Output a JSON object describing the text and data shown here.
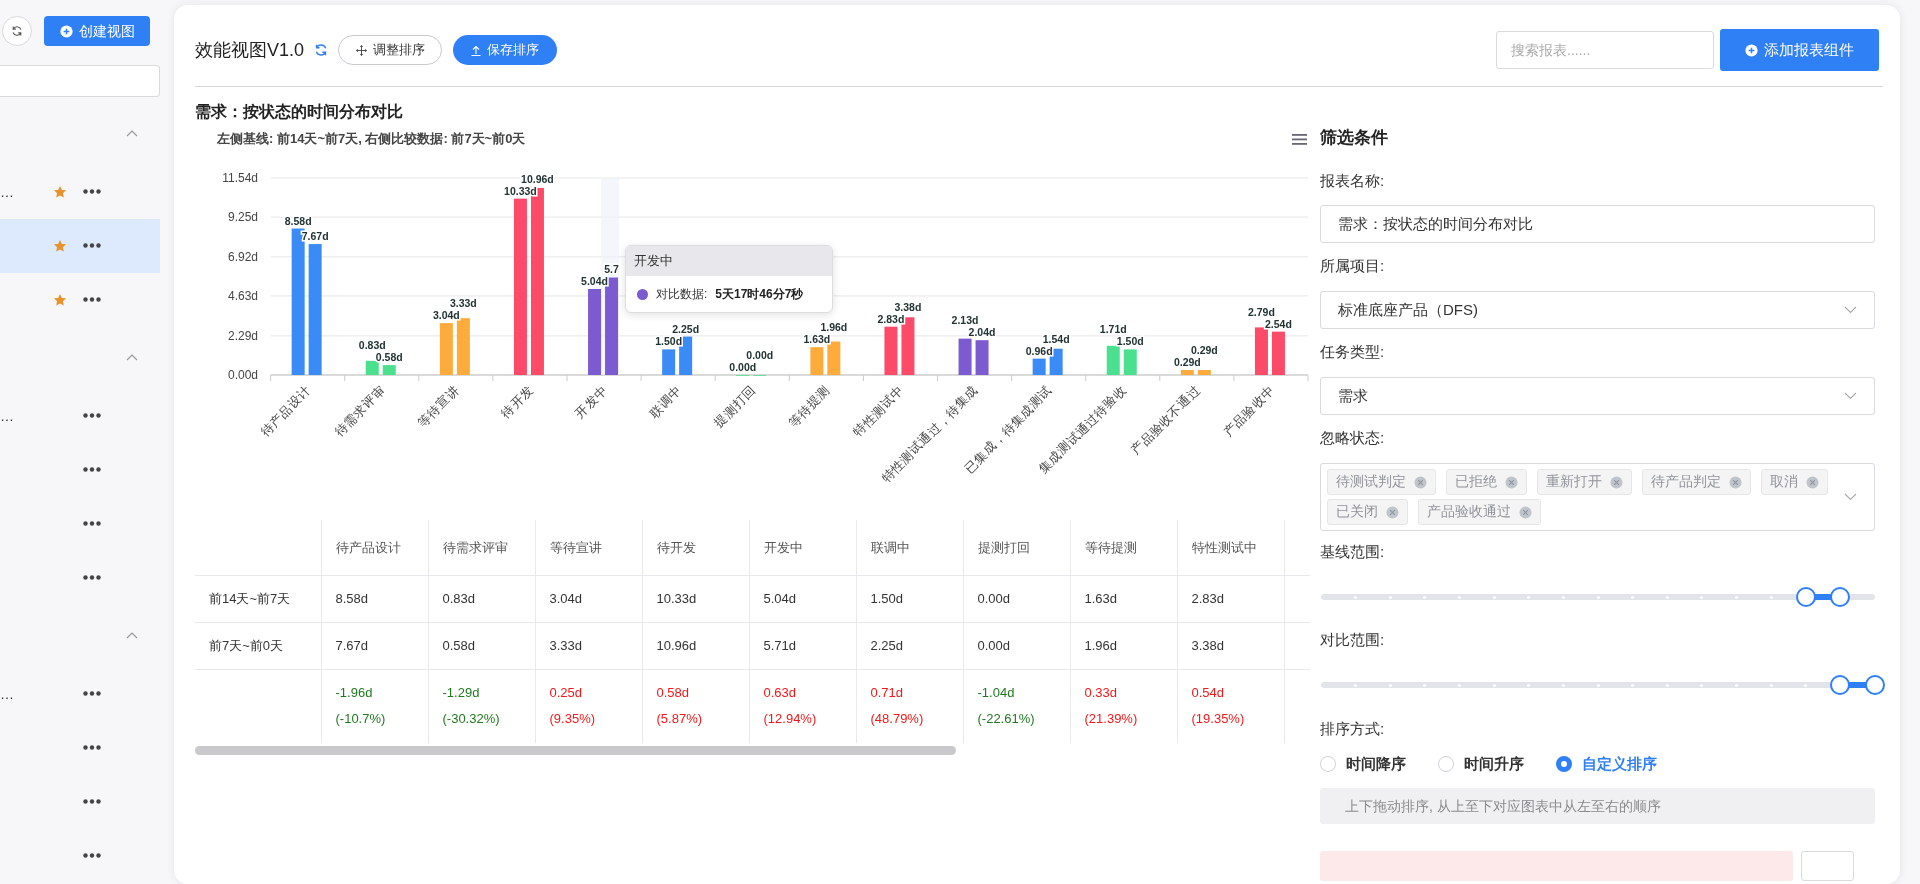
{
  "sidebar": {
    "create_button": "创建视图",
    "groups": [
      {
        "expanded": true,
        "items": [
          {
            "label": "…",
            "starred": true,
            "selected": false
          },
          {
            "starred": true,
            "selected": true
          },
          {
            "starred": true,
            "selected": false
          }
        ]
      },
      {
        "expanded": true,
        "items": [
          {
            "label": "…",
            "starred": false,
            "selected": false
          },
          {
            "starred": false,
            "selected": false
          },
          {
            "starred": false,
            "selected": false
          },
          {
            "starred": false,
            "selected": false
          }
        ]
      },
      {
        "expanded": true,
        "items": [
          {
            "label": "…",
            "starred": false,
            "selected": false
          },
          {
            "starred": false,
            "selected": false
          },
          {
            "starred": false,
            "selected": false
          },
          {
            "starred": false,
            "selected": false
          }
        ]
      }
    ]
  },
  "header": {
    "title": "效能视图V1.0",
    "adjust_button": "调整排序",
    "save_button": "保存排序",
    "search": {
      "placeholder": "搜索报表......"
    },
    "add_button": "添加报表组件"
  },
  "report": {
    "title": "需求：按状态的时间分布对比",
    "subtitle": "左侧基线: 前14天~前7天, 右侧比较数据: 前7天~前0天",
    "chart_data": {
      "type": "bar",
      "categories": [
        "待产品设计",
        "待需求评审",
        "等待宣讲",
        "待开发",
        "开发中",
        "联调中",
        "提测打回",
        "等待提测",
        "特性测试中",
        "特性测试通过，待集成",
        "已集成，待集成测试",
        "集成测试通过待验收",
        "产品验收不通过",
        "产品验收中"
      ],
      "grid": true,
      "series": [
        {
          "colors": [
            "#3b8bf6",
            "#4be08f",
            "#fdab3a",
            "#fb4b69",
            "#7c5ad0",
            "#3b8bf6",
            "#4be08f",
            "#fdab3a",
            "#fb4b69",
            "#7c5ad0",
            "#3b8bf6",
            "#4be08f",
            "#fdab3a",
            "#fb4b69"
          ],
          "values": [
            8.58,
            0.83,
            3.04,
            10.33,
            5.04,
            1.5,
            0,
            1.63,
            2.83,
            2.13,
            0.96,
            1.71,
            0.29,
            2.79
          ]
        },
        {
          "colors": [
            "#3b8bf6",
            "#4be08f",
            "#fdab3a",
            "#fb4b69",
            "#7c5ad0",
            "#3b8bf6",
            "#4be08f",
            "#fdab3a",
            "#fb4b69",
            "#7c5ad0",
            "#3b8bf6",
            "#4be08f",
            "#fdab3a",
            "#fb4b69"
          ],
          "values": [
            7.67,
            0.58,
            3.33,
            10.96,
            5.71,
            2.25,
            0,
            1.96,
            3.38,
            2.04,
            1.54,
            1.5,
            0.29,
            2.54
          ]
        }
      ],
      "value_labels": [
        [
          "8.58d",
          "0.83d",
          "3.04d",
          "10.33d",
          "5.04d",
          "1.50d",
          "0.00d",
          "1.63d",
          "2.83d",
          "2.13d",
          "0.96d",
          "1.71d",
          "0.29d",
          "2.79d"
        ],
        [
          "7.67d",
          "0.58d",
          "3.33d",
          "10.96d",
          "5.7",
          "2.25d",
          "0.00d",
          "1.96d",
          "3.38d",
          "2.04d",
          "1.54d",
          "1.50d",
          "0.29d",
          "2.54d"
        ]
      ],
      "ylim": [
        0,
        11.54
      ],
      "yticks": [
        {
          "value": 0,
          "label": "0.00d"
        },
        {
          "value": 2.29,
          "label": "2.29d"
        },
        {
          "value": 4.63,
          "label": "4.63d"
        },
        {
          "value": 6.92,
          "label": "6.92d"
        },
        {
          "value": 9.25,
          "label": "9.25d"
        },
        {
          "value": 11.54,
          "label": "11.54d"
        }
      ]
    },
    "tooltip": {
      "title": "开发中",
      "label": "对比数据:",
      "value": "5天17时46分7秒",
      "color": "#7c5ad0"
    },
    "table": {
      "columns": [
        "待产品设计",
        "待需求评审",
        "等待宣讲",
        "待开发",
        "开发中",
        "联调中",
        "提测打回",
        "等待提测",
        "特性测试中"
      ],
      "rows": [
        {
          "label": "前14天~前7天",
          "cells": [
            {
              "value": "8.58d"
            },
            {
              "value": "0.83d"
            },
            {
              "value": "3.04d"
            },
            {
              "value": "10.33d"
            },
            {
              "value": "5.04d"
            },
            {
              "value": "1.50d"
            },
            {
              "value": "0.00d"
            },
            {
              "value": "1.63d"
            },
            {
              "value": "2.83d"
            }
          ]
        },
        {
          "label": "前7天~前0天",
          "cells": [
            {
              "value": "7.67d"
            },
            {
              "value": "0.58d"
            },
            {
              "value": "3.33d"
            },
            {
              "value": "10.96d"
            },
            {
              "value": "5.71d"
            },
            {
              "value": "2.25d"
            },
            {
              "value": "0.00d"
            },
            {
              "value": "1.96d"
            },
            {
              "value": "3.38d"
            }
          ]
        },
        {
          "cells": [
            {
              "value": "-1.96d",
              "percent": "(-10.7%)",
              "color": "#1f7a1f"
            },
            {
              "value": "-1.29d",
              "percent": "(-30.32%)",
              "color": "#1f7a1f"
            },
            {
              "value": "0.25d",
              "percent": "(9.35%)",
              "color": "#f01818"
            },
            {
              "value": "0.58d",
              "percent": "(5.87%)",
              "color": "#f01818"
            },
            {
              "value": "0.63d",
              "percent": "(12.94%)",
              "color": "#f01818"
            },
            {
              "value": "0.71d",
              "percent": "(48.79%)",
              "color": "#f01818"
            },
            {
              "value": "-1.04d",
              "percent": "(-22.61%)",
              "color": "#1f7a1f"
            },
            {
              "value": "0.33d",
              "percent": "(21.39%)",
              "color": "#f01818"
            },
            {
              "value": "0.54d",
              "percent": "(19.35%)",
              "color": "#f01818"
            }
          ]
        }
      ]
    }
  },
  "filters": {
    "title": "筛选条件",
    "name": {
      "label": "报表名称:",
      "value": "需求：按状态的时间分布对比"
    },
    "project": {
      "label": "所属项目:",
      "value": "标准底座产品（DFS)"
    },
    "task_type": {
      "label": "任务类型:",
      "value": "需求"
    },
    "ignored_states": {
      "label": "忽略状态:",
      "tags": [
        "待测试判定",
        "已拒绝",
        "重新打开",
        "待产品判定",
        "取消",
        "已关闭",
        "产品验收通过"
      ]
    },
    "baseline_range": {
      "label": "基线范围:",
      "thumbs": [
        {
          "level": 0.875
        },
        {
          "level": 0.9375
        }
      ]
    },
    "compare_range": {
      "label": "对比范围:",
      "thumbs": [
        {
          "level": 0.9375
        },
        {
          "level": 1
        }
      ]
    },
    "sort": {
      "label": "排序方式:",
      "options": [
        {
          "label": "时间降序",
          "selected": false
        },
        {
          "label": "时间升序",
          "selected": false
        },
        {
          "label": "自定义排序",
          "selected": true
        }
      ]
    },
    "hint": "上下拖动排序, 从上至下对应图表中从左至右的顺序"
  }
}
